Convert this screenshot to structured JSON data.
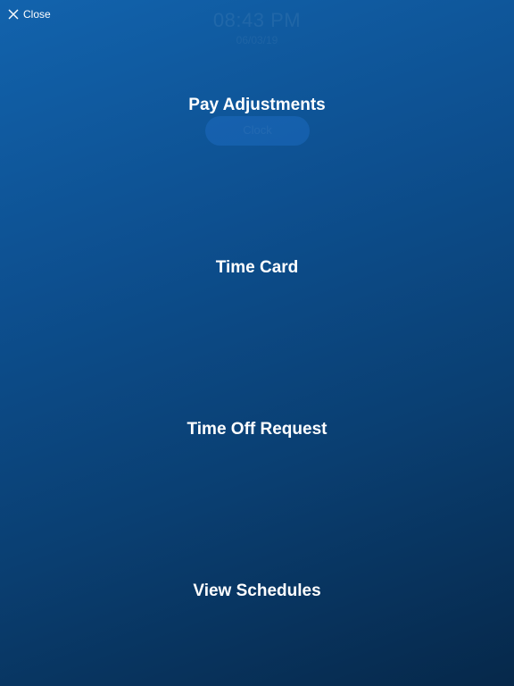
{
  "background": {
    "ghost_time": "08:43 PM",
    "ghost_date": "06/03/19",
    "ghost_button_label": "Clock"
  },
  "close": {
    "label": "Close",
    "icon": "close-icon"
  },
  "menu": {
    "items": [
      {
        "label": "Pay Adjustments"
      },
      {
        "label": "Time Card"
      },
      {
        "label": "Time Off Request"
      },
      {
        "label": "View Schedules"
      }
    ]
  },
  "colors": {
    "gradient_top": "#1263ad",
    "gradient_bottom": "#06284a",
    "text": "#ffffff"
  }
}
